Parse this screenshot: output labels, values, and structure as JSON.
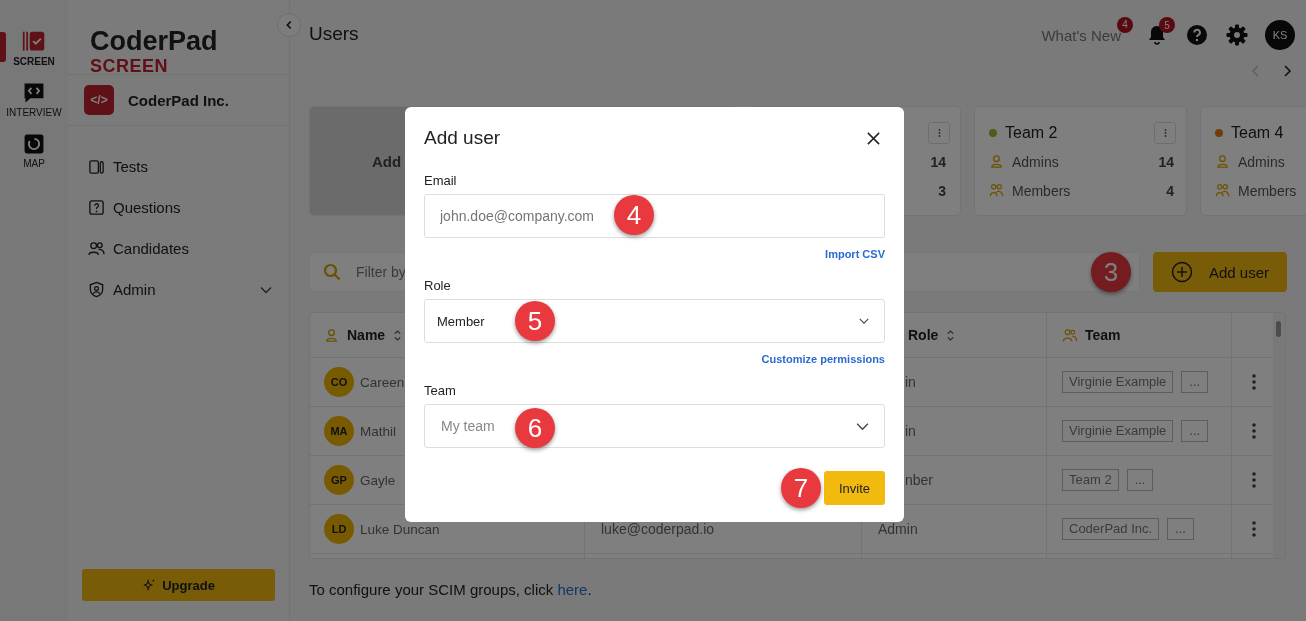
{
  "rail": [
    {
      "label": "SCREEN",
      "kind": "screen",
      "selected": true
    },
    {
      "label": "INTERVIEW",
      "kind": "interview",
      "selected": false
    },
    {
      "label": "MAP",
      "kind": "map",
      "selected": false
    }
  ],
  "brand": {
    "name": "CoderPad",
    "product": "SCREEN"
  },
  "org": {
    "logo": "</>",
    "name": "CoderPad Inc."
  },
  "nav": [
    {
      "label": "Tests",
      "kind": "tests"
    },
    {
      "label": "Questions",
      "kind": "questions"
    },
    {
      "label": "Candidates",
      "kind": "candidates"
    },
    {
      "label": "Admin",
      "kind": "admin",
      "expanded": false
    }
  ],
  "upgrade": "Upgrade",
  "page_title": "Users",
  "header": {
    "whats_new": "What's New",
    "whats_new_badge": "4",
    "notifications_badge": "5",
    "avatar": "KS"
  },
  "cards": [
    {
      "kind": "add",
      "label": "Add"
    },
    {
      "kind": "partial",
      "admins_count": "14",
      "members_count": "3"
    },
    {
      "kind": "team",
      "name": "Team 2",
      "color": "#4e5c1b",
      "admins_label": "Admins",
      "admins_count": "14",
      "members_label": "Members",
      "members_count": "4"
    },
    {
      "kind": "team",
      "name": "Team 4",
      "color": "#703d09",
      "admins_label": "Admins",
      "members_label": "Members"
    }
  ],
  "search": {
    "placeholder": "Filter by"
  },
  "add_user": {
    "label": "Add user",
    "callout": "3"
  },
  "table": {
    "name_header": "Name",
    "role_header": "Role",
    "team_header": "Team",
    "rows": [
      {
        "initials": "CO",
        "name": "Careen",
        "role": "in",
        "role_partial": true,
        "team": "Virginie Example",
        "team_more": "..."
      },
      {
        "initials": "MA",
        "name": "Mathil",
        "role": "in",
        "role_partial": true,
        "team": "Virginie Example",
        "team_more": "..."
      },
      {
        "initials": "GP",
        "name": "Gayle",
        "role": "nber",
        "role_partial": true,
        "team": "Team 2",
        "team_more": "..."
      },
      {
        "initials": "LD",
        "name": "Luke Duncan",
        "email": "luke@coderpad.io",
        "role": "Admin",
        "role_partial": false,
        "team": "CoderPad Inc.",
        "team_more": "..."
      }
    ]
  },
  "footer": {
    "text": "To configure your SCIM groups, click ",
    "link": "here",
    "after": "."
  },
  "dialog": {
    "title": "Add user",
    "email_label": "Email",
    "email_placeholder": "john.doe@company.com",
    "email_callout": "4",
    "import_link": "Import CSV",
    "role_label": "Role",
    "role_value": "Member",
    "role_callout": "5",
    "permissions_link": "Customize permissions",
    "team_label": "Team",
    "team_placeholder": "My team",
    "team_callout": "6",
    "invite": "Invite",
    "invite_callout": "7"
  }
}
